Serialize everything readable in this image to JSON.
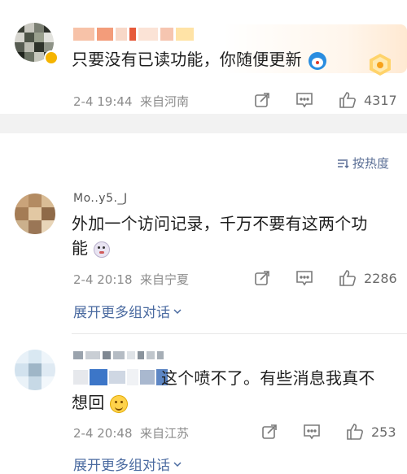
{
  "comments": [
    {
      "text": "只要没有已读功能，你随便更新",
      "time": "2-4 19:44",
      "location": "来自河南",
      "likes": "4317"
    },
    {
      "name": "Mo..y5._J",
      "text_line1": "外加一个访问记录，千万不要有这两个功",
      "text_line2": "能",
      "time": "2-4 20:18",
      "location": "来自宁夏",
      "likes": "2286",
      "expand": "展开更多组对话"
    },
    {
      "text_line1": "这个喷不了。有些消息我真不",
      "text_line2": "想回",
      "time": "2-4 20:48",
      "location": "来自江苏",
      "likes": "253",
      "expand": "展开更多组对话"
    }
  ],
  "sort_label": "按热度",
  "icons": [
    "share-icon",
    "comment-icon",
    "like-icon",
    "sort-icon",
    "chevron-down-icon"
  ],
  "colors": {
    "link": "#4a6aa0",
    "meta": "#8c8c8c",
    "bg_gap": "#f2f2f2"
  }
}
